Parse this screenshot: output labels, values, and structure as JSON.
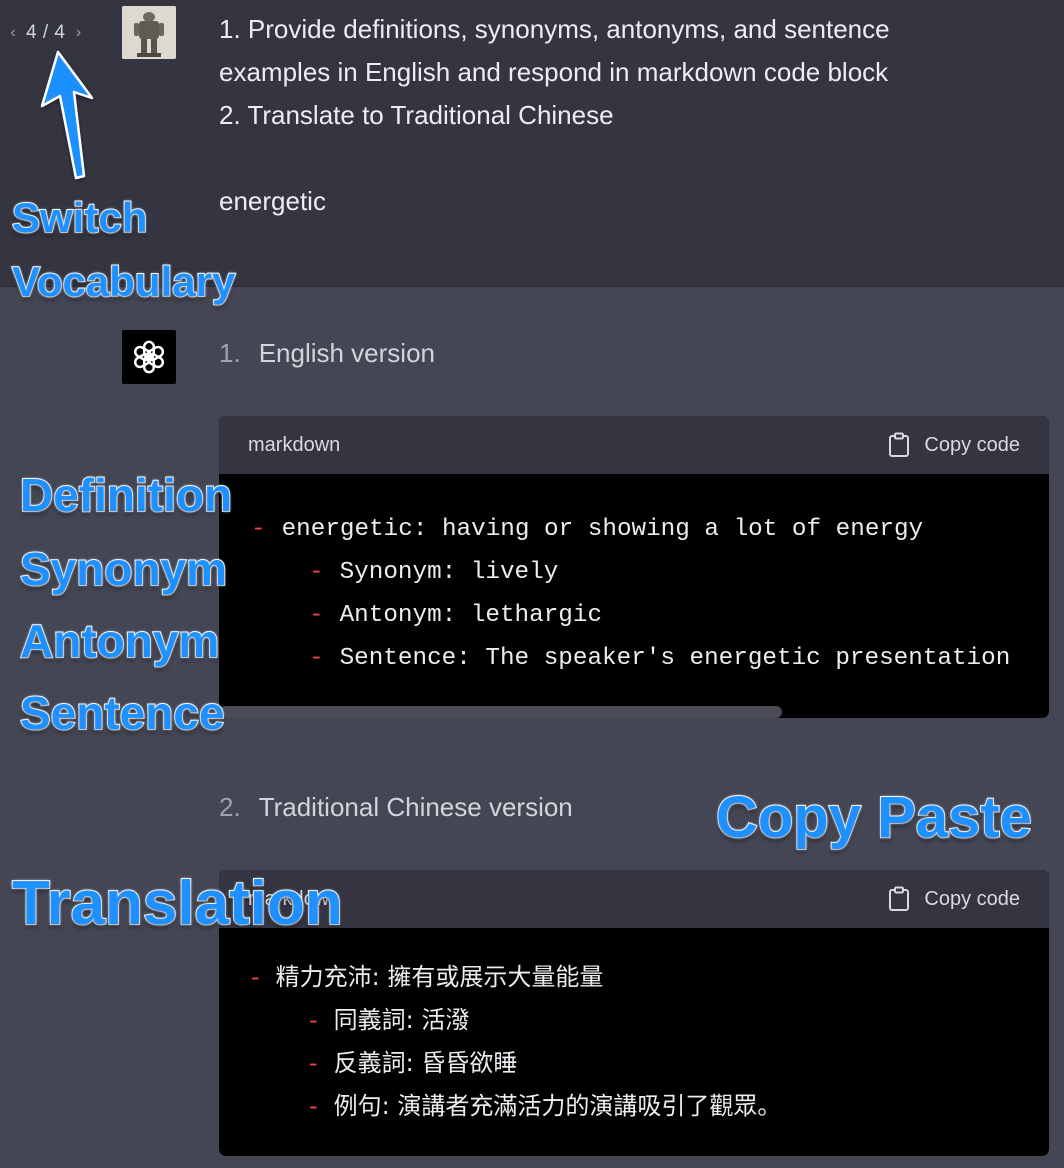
{
  "user_message": {
    "pager": {
      "prev_icon": "chevron-left-icon",
      "text": "4 / 4",
      "next_icon": "chevron-right-icon"
    },
    "lines": [
      "1. Provide definitions, synonyms, antonyms, and sentence",
      "examples in English and respond in markdown code block",
      "2. Translate to Traditional Chinese",
      "",
      "energetic"
    ]
  },
  "assistant_message": {
    "avatar_icon": "openai-logo-icon",
    "sections": [
      {
        "number": "1.",
        "title": "English version",
        "code": {
          "language": "markdown",
          "copy_label": "Copy code",
          "lines": [
            {
              "dash": "-",
              "text": "energetic: having or showing a lot of energy"
            },
            {
              "dash": "-",
              "text": "Synonym: lively"
            },
            {
              "dash": "-",
              "text": "Antonym: lethargic"
            },
            {
              "dash": "-",
              "text": "Sentence: The speaker's energetic presentation"
            }
          ]
        }
      },
      {
        "number": "2.",
        "title": "Traditional Chinese version",
        "code": {
          "language": "markdown",
          "copy_label": "Copy code",
          "lines": [
            {
              "dash": "-",
              "text": "精力充沛: 擁有或展示大量能量"
            },
            {
              "dash": "-",
              "text": "同義詞: 活潑"
            },
            {
              "dash": "-",
              "text": "反義詞: 昏昏欲睡"
            },
            {
              "dash": "-",
              "text": "例句: 演講者充滿活力的演講吸引了觀眾。"
            }
          ]
        }
      }
    ]
  },
  "annotations": {
    "switch": "Switch",
    "vocabulary": "Vocabulary",
    "definition": "Definition",
    "synonym": "Synonym",
    "antonym": "Antonym",
    "sentence": "Sentence",
    "copy_paste": "Copy Paste",
    "translation": "Translation"
  },
  "colors": {
    "user_bg": "#343541",
    "assistant_bg": "#444654",
    "code_bg": "#000000",
    "dash_red": "#ef4146",
    "annotation_blue": "#1e90ff"
  }
}
